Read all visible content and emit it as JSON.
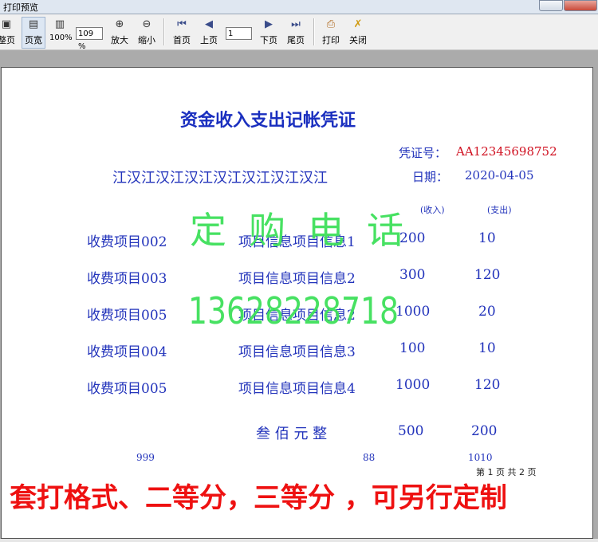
{
  "window": {
    "title": "打印预览"
  },
  "toolbar": {
    "whole_page": "整页",
    "page_width": "页宽",
    "zoom_100": "100%",
    "zoom_value": "109 %",
    "zoom_in": "放大",
    "zoom_out": "缩小",
    "first_page": "首页",
    "prev_page": "上页",
    "page_input": "1",
    "next_page": "下页",
    "last_page": "尾页",
    "print": "打印",
    "close": "关闭"
  },
  "document": {
    "title": "资金收入支出记帐凭证",
    "voucher_label": "凭证号：",
    "voucher_no": "AA12345698752",
    "company": "江汉江汉江汉江汉江汉江汉江汉江",
    "date_label": "日期：",
    "date_value": "2020-04-05",
    "income_head": "(收入)",
    "expense_head": "(支出)",
    "rows": [
      {
        "item": "收费项目002",
        "info": "项目信息项目信息1",
        "income": "200",
        "expense": "10"
      },
      {
        "item": "收费项目003",
        "info": "项目信息项目信息2",
        "income": "300",
        "expense": "120"
      },
      {
        "item": "收费项目005",
        "info": "项目信息项目信息2",
        "income": "1000",
        "expense": "20"
      },
      {
        "item": "收费项目004",
        "info": "项目信息项目信息3",
        "income": "100",
        "expense": "10"
      },
      {
        "item": "收费项目005",
        "info": "项目信息项目信息4",
        "income": "1000",
        "expense": "120"
      }
    ],
    "total_words": "叁 佰 元 整",
    "total_income": "500",
    "total_expense": "200",
    "footer_left": "999",
    "footer_mid": "88",
    "footer_right": "1010",
    "page_info": "第 1 页  共 2 页"
  },
  "watermark": {
    "phone_label": "定购电话",
    "phone": "13628228718"
  },
  "banner": "套打格式、二等分，三等分 ，可另行定制",
  "colors": {
    "title_blue": "#1a2fbf",
    "text_blue": "#2233bb",
    "voucher_red": "#d01020",
    "watermark_green": "#3ee05a",
    "banner_red": "#ee1111"
  }
}
